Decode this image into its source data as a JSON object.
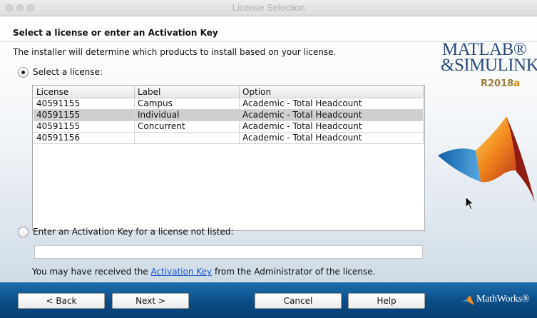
{
  "window": {
    "title": "License Selection"
  },
  "heading": "Select a license or enter an Activation Key",
  "description": "The installer will determine which products to install based on your license.",
  "select_license": {
    "label": "Select a license:",
    "checked": true
  },
  "table": {
    "headers": [
      "License",
      "Label",
      "Option"
    ],
    "rows": [
      [
        "40591155",
        "Campus",
        "Academic - Total Headcount"
      ],
      [
        "40591155",
        "Individual",
        "Academic - Total Headcount"
      ],
      [
        "40591155",
        "Concurrent",
        "Academic - Total Headcount"
      ],
      [
        "40591156",
        "",
        "Academic - Total Headcount"
      ]
    ],
    "selected_row": 1
  },
  "activation": {
    "label": "Enter an Activation Key for a license not listed:",
    "checked": false,
    "value": "",
    "note_prefix": "You may have received the ",
    "note_link": "Activation Key",
    "note_suffix": " from the Administrator of the license."
  },
  "buttons": {
    "back": "< Back",
    "next": "Next >",
    "cancel": "Cancel",
    "help": "Help"
  },
  "branding": {
    "product_line1": "MATLAB®",
    "product_line2": "&SIMULINK®",
    "release_prefix": "R2018",
    "release_suffix": "a",
    "vendor": "MathWorks®"
  },
  "colors": {
    "footer_top": "#1d6fb0",
    "footer_bottom": "#073e6f",
    "link": "#1a56c8",
    "selected_row": "#cfcfcf",
    "brand_blue": "#2a4a7a",
    "release_orange": "#d98a00"
  }
}
